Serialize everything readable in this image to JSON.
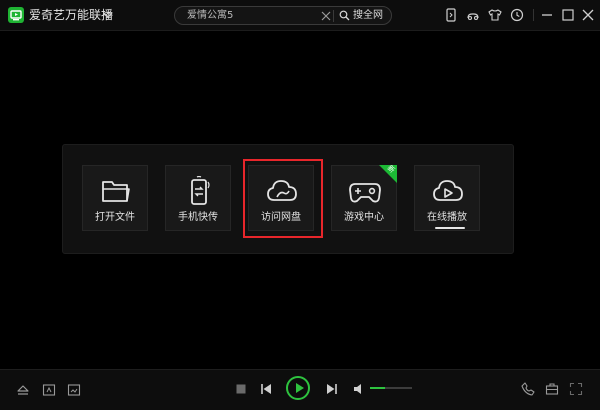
{
  "app": {
    "title": "爱奇艺万能联播"
  },
  "search": {
    "value": "爱情公寓5",
    "button_label": "搜全网"
  },
  "toolbar_icons": [
    "phone-sync-icon",
    "link-icon",
    "skin-tshirt-icon",
    "history-clock-icon",
    "minimize-icon",
    "maximize-icon",
    "close-icon"
  ],
  "launcher": {
    "tiles": [
      {
        "label": "打开文件",
        "icon": "folder-icon"
      },
      {
        "label": "手机快传",
        "icon": "phone-transfer-icon"
      },
      {
        "label": "访问网盘",
        "icon": "cloud-drive-icon",
        "highlighted": true
      },
      {
        "label": "游戏中心",
        "icon": "gamepad-icon",
        "badge": "新"
      },
      {
        "label": "在线播放",
        "icon": "cloud-play-icon"
      }
    ]
  },
  "player": {
    "volume_level": 0.35,
    "left_icons": [
      "eject-icon",
      "subtitle-icon",
      "screenshot-icon"
    ],
    "right_icons": [
      "phone-icon",
      "toolbox-icon",
      "fullscreen-icon"
    ]
  },
  "colors": {
    "accent": "#2ec33f",
    "highlight": "#e8262b",
    "background": "#000000"
  }
}
